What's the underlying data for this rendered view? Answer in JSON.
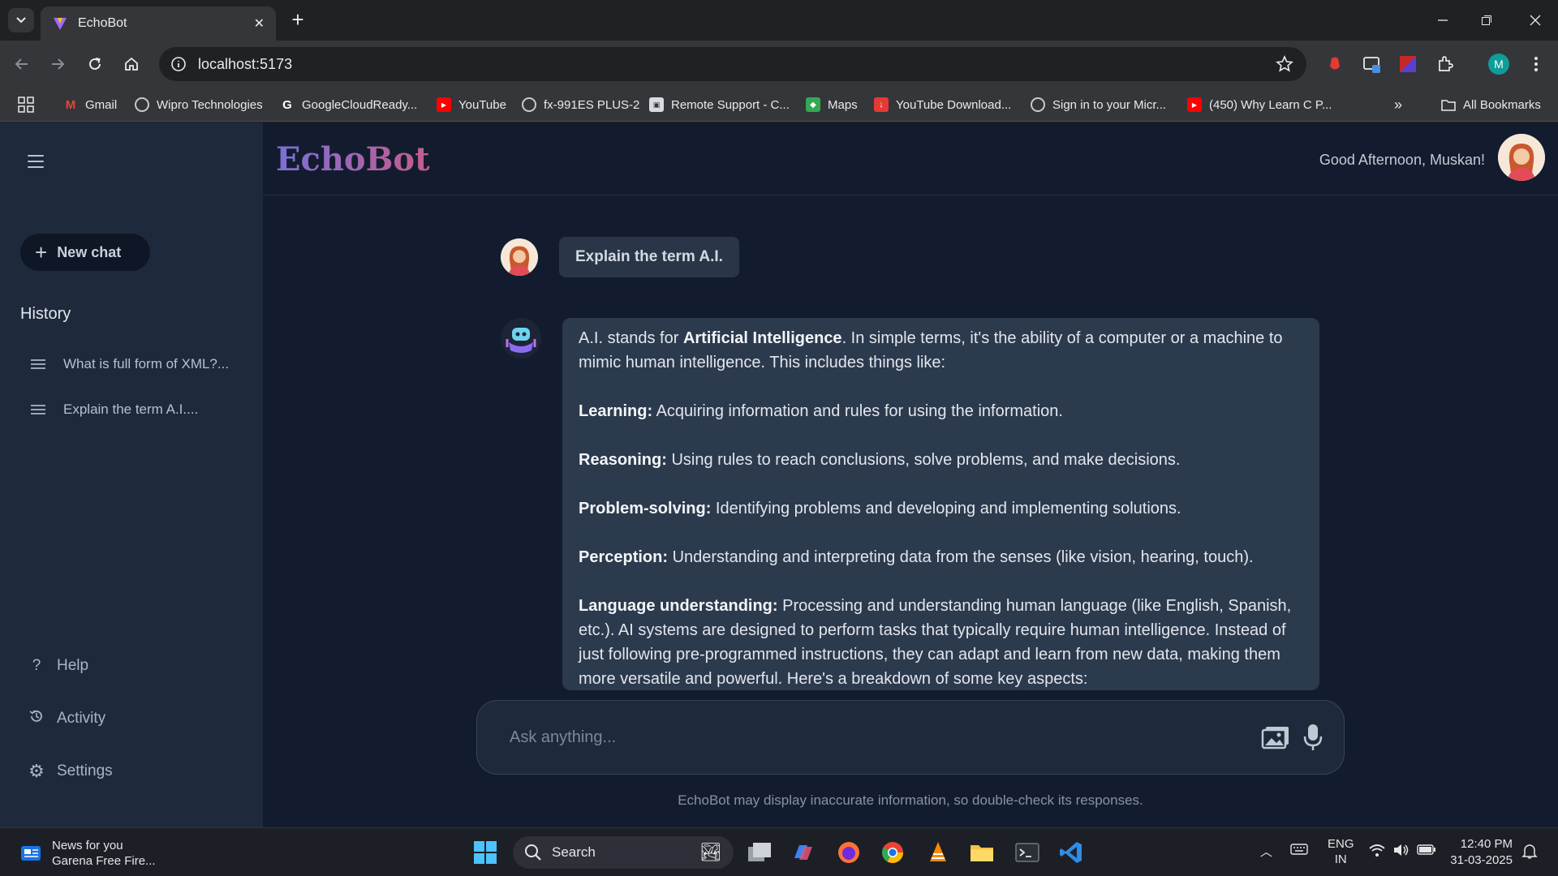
{
  "browser": {
    "tab_title": "EchoBot",
    "url": "localhost:5173",
    "bookmarks": [
      {
        "label": "Gmail",
        "icon": "gmail-icon"
      },
      {
        "label": "Wipro Technologies",
        "icon": "globe-icon"
      },
      {
        "label": "GoogleCloudReady...",
        "icon": "google-icon"
      },
      {
        "label": "YouTube",
        "icon": "youtube-icon"
      },
      {
        "label": "fx-991ES PLUS-2",
        "icon": "globe-icon"
      },
      {
        "label": "Remote Support - C...",
        "icon": "remote-support-icon"
      },
      {
        "label": "Maps",
        "icon": "maps-icon"
      },
      {
        "label": "YouTube Download...",
        "icon": "download-icon"
      },
      {
        "label": "Sign in to your Micr...",
        "icon": "globe-icon"
      },
      {
        "label": "(450) Why Learn C P...",
        "icon": "youtube-icon"
      }
    ],
    "all_bookmarks_label": "All Bookmarks",
    "profile_initial": "M"
  },
  "app": {
    "logo": "EchoBot",
    "greeting": "Good Afternoon, Muskan!",
    "new_chat_label": "New chat",
    "history_title": "History",
    "history": [
      "What is full form of XML?...",
      "Explain the term A.I...."
    ],
    "bottom_nav": [
      {
        "label": "Help",
        "icon": "help-icon"
      },
      {
        "label": "Activity",
        "icon": "history-icon"
      },
      {
        "label": "Settings",
        "icon": "gear-icon"
      }
    ],
    "user_message": "Explain the term A.I.",
    "bot_response": {
      "intro_prefix": "A.I. stands for ",
      "intro_bold": "Artificial Intelligence",
      "intro_suffix": ". In simple terms, it's the ability of a computer or a machine to mimic human intelligence. This includes things like:",
      "points": [
        {
          "term": "Learning:",
          "text": " Acquiring information and rules for using the information."
        },
        {
          "term": "Reasoning:",
          "text": " Using rules to reach conclusions, solve problems, and make decisions."
        },
        {
          "term": "Problem-solving:",
          "text": " Identifying problems and developing and implementing solutions."
        },
        {
          "term": "Perception:",
          "text": " Understanding and interpreting data from the senses (like vision, hearing, touch)."
        },
        {
          "term": "Language understanding:",
          "text": " Processing and understanding human language (like English, Spanish, etc.). AI systems are designed to perform tasks that typically require human intelligence. Instead of just following pre-programmed instructions, they can adapt and learn from new data, making them more versatile and powerful. Here's a breakdown of some key aspects:"
        }
      ]
    },
    "input_placeholder": "Ask anything...",
    "disclaimer": "EchoBot may display inaccurate information, so double-check its responses."
  },
  "taskbar": {
    "news_title": "News for you",
    "news_sub": "Garena Free Fire...",
    "search_label": "Search",
    "lang_top": "ENG",
    "lang_bottom": "IN",
    "time": "12:40 PM",
    "date": "31-03-2025"
  },
  "colors": {
    "app_bg": "#131c2e",
    "sidebar_bg": "#1e2a3c",
    "bubble_bg": "#2c3a4e",
    "logo_gradient_start": "#7b6fd8",
    "logo_gradient_end": "#c45d8a"
  }
}
